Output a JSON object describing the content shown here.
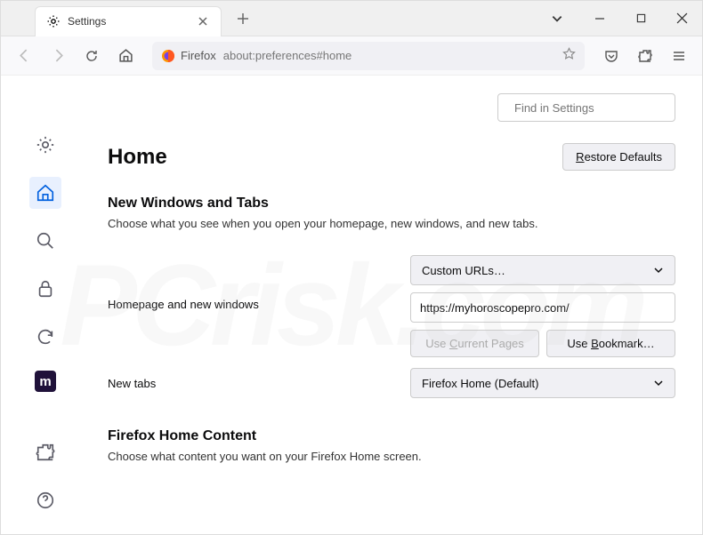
{
  "titlebar": {
    "tab_title": "Settings"
  },
  "navbar": {
    "identity": "Firefox",
    "url": "about:preferences#home"
  },
  "search": {
    "placeholder": "Find in Settings"
  },
  "page": {
    "title": "Home",
    "restore_defaults": "Restore Defaults"
  },
  "section1": {
    "title": "New Windows and Tabs",
    "desc": "Choose what you see when you open your homepage, new windows, and new tabs."
  },
  "homepage": {
    "label": "Homepage and new windows",
    "select_value": "Custom URLs…",
    "input_value": "https://myhoroscopepro.com/",
    "use_current": "Use Current Pages",
    "use_bookmark": "Use Bookmark…"
  },
  "newtabs": {
    "label": "New tabs",
    "select_value": "Firefox Home (Default)"
  },
  "section2": {
    "title": "Firefox Home Content",
    "desc": "Choose what content you want on your Firefox Home screen."
  },
  "watermark": "PCrisk.com"
}
